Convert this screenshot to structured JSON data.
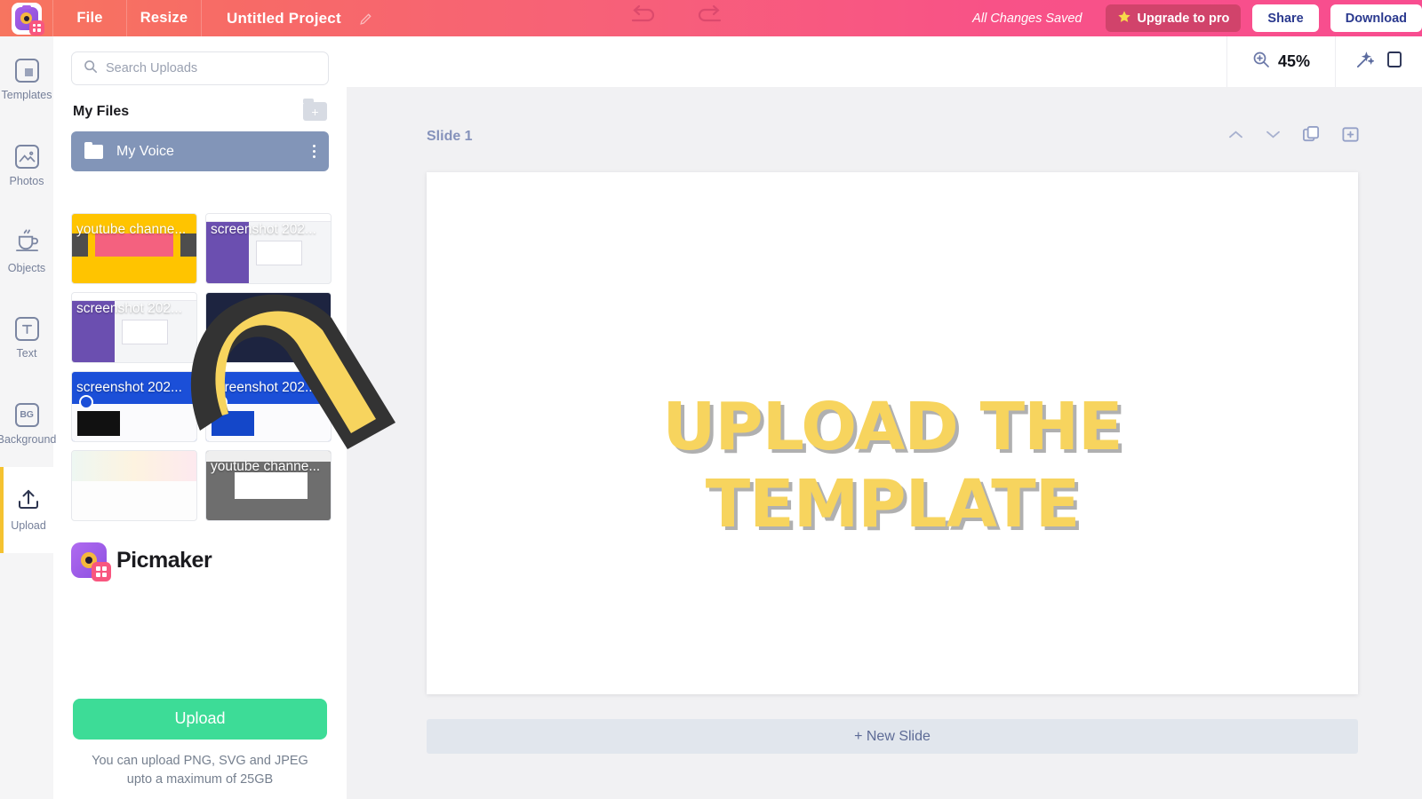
{
  "header": {
    "logo_icon": "picmaker-camera-logo-icon",
    "file_label": "File",
    "resize_label": "Resize",
    "project_title": "Untitled Project",
    "edit_title_icon": "pencil-icon",
    "undo_icon": "undo-arrow-icon",
    "redo_icon": "redo-arrow-icon",
    "save_status": "All Changes Saved",
    "upgrade_label": "Upgrade to pro",
    "upgrade_icon": "star-icon",
    "share_label": "Share",
    "download_label": "Download",
    "gradient_start": "#f7755f",
    "gradient_end": "#f84d90",
    "upgrade_bg": "#d1436b"
  },
  "rail": {
    "items": [
      {
        "label": "Templates",
        "icon": "templates-icon",
        "active": false
      },
      {
        "label": "Photos",
        "icon": "photo-mountain-icon",
        "active": false
      },
      {
        "label": "Objects",
        "icon": "coffee-cup-icon",
        "active": false
      },
      {
        "label": "Text",
        "icon": "text-t-icon",
        "active": false
      },
      {
        "label": "Background",
        "icon": "bg-icon",
        "active": false
      },
      {
        "label": "Upload",
        "icon": "upload-arrow-icon",
        "active": true
      }
    ],
    "active_accent": "#f5c230"
  },
  "panel": {
    "search_placeholder": "Search Uploads",
    "search_value": "",
    "search_icon": "search-icon",
    "my_files_label": "My Files",
    "new_folder_icon": "new-folder-icon",
    "folder": {
      "name": "My Voice",
      "icon": "folder-icon",
      "menu_icon": "kebab-menu-icon",
      "bg": "#8295b8"
    },
    "thumbnails": [
      {
        "caption": "youtube channe...",
        "style": "t-yellow"
      },
      {
        "caption": "screenshot 202...",
        "style": "t-grey"
      },
      {
        "caption": "screenshot 202...",
        "style": "t-grey"
      },
      {
        "caption": "",
        "style": "t-dark"
      },
      {
        "caption": "screenshot 202...",
        "style": "t-blue"
      },
      {
        "caption": "screenshot 202...",
        "style": "t-blue"
      },
      {
        "caption": "",
        "style": "t-light"
      },
      {
        "caption": "youtube channe...",
        "style": "t-dark"
      }
    ],
    "brand_name": "Picmaker",
    "brand_icon": "picmaker-logo-icon",
    "upload_label": "Upload",
    "upload_hint": "You can upload PNG, SVG and JPEG",
    "upload_hint_2": "upto a maximum of 25GB",
    "upload_btn_color": "#3ddc97",
    "collapse_icon": "chevron-left-icon"
  },
  "toolbar": {
    "zoom_icon": "zoom-in-magnifier-icon",
    "zoom_level": "45%",
    "wand_icon": "magic-wand-icon"
  },
  "slide": {
    "label": "Slide 1",
    "move_up_icon": "chevron-up-icon",
    "move_down_icon": "chevron-down-icon",
    "duplicate_icon": "duplicate-slide-icon",
    "add_icon": "add-slide-icon",
    "canvas_text_line1": "UPLOAD THE",
    "canvas_text_line2": "TEMPLATE",
    "canvas_text_color": "#f7d45e",
    "new_slide_label": "+ New Slide"
  },
  "overlay": {
    "cursor_icon": "large-arrow-cursor-annotation",
    "fill": "#f7d45e",
    "outline": "#333333"
  }
}
